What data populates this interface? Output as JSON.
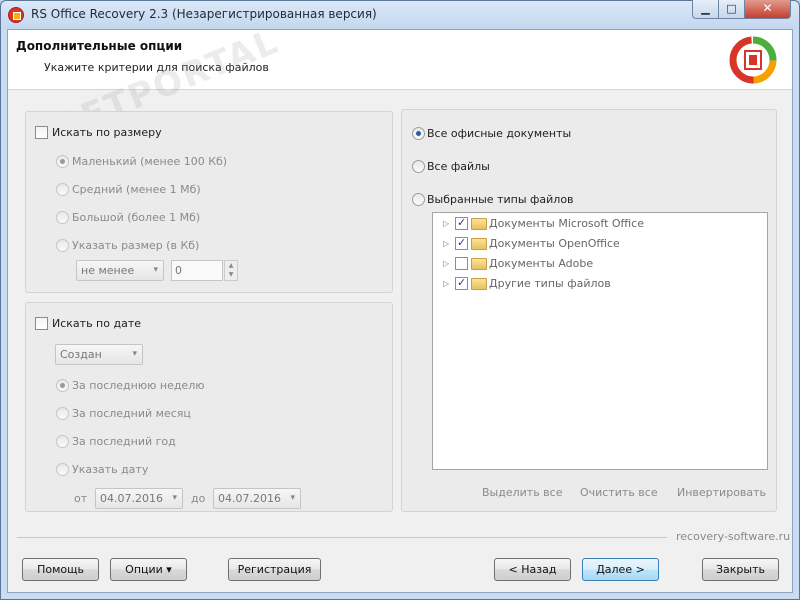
{
  "window": {
    "title": "RS Office Recovery 2.3 (Незарегистрированная версия)"
  },
  "header": {
    "title": "Дополнительные опции",
    "subtitle": "Укажите критерии для поиска файлов"
  },
  "size_group": {
    "checkbox_label": "Искать по размеру",
    "options": [
      "Маленький (менее 100 Кб)",
      "Средний (менее 1 Мб)",
      "Большой (более 1 Мб)",
      "Указать размер (в Кб)"
    ],
    "selected_index": 0,
    "comparator": "не менее",
    "size_value": "0"
  },
  "date_group": {
    "checkbox_label": "Искать по дате",
    "date_type": "Создан",
    "options": [
      "За последнюю неделю",
      "За последний месяц",
      "За последний год",
      "Указать дату"
    ],
    "selected_index": 0,
    "from_label": "от",
    "from_value": "04.07.2016",
    "to_label": "до",
    "to_value": "04.07.2016"
  },
  "file_types": {
    "options": [
      "Все офисные документы",
      "Все файлы",
      "Выбранные типы файлов"
    ],
    "selected_index": 0,
    "tree": [
      {
        "label": "Документы Microsoft Office",
        "checked": true
      },
      {
        "label": "Документы OpenOffice",
        "checked": true
      },
      {
        "label": "Документы Adobe",
        "checked": false
      },
      {
        "label": "Другие типы файлов",
        "checked": true
      }
    ],
    "select_all": "Выделить все",
    "clear_all": "Очистить все",
    "invert": "Инвертировать"
  },
  "brand_text": "recovery-software.ru",
  "buttons": {
    "help": "Помощь",
    "options": "Опции ▾",
    "register": "Регистрация",
    "back": "< Назад",
    "next": "Далее >",
    "close": "Закрыть"
  },
  "colors": {
    "accent": "#3c7fb1",
    "titlebar": "#c3d7ee",
    "close_button": "#c4402c",
    "logo_red": "#d8352a",
    "logo_green": "#4caf3a",
    "logo_orange": "#f5a100"
  }
}
